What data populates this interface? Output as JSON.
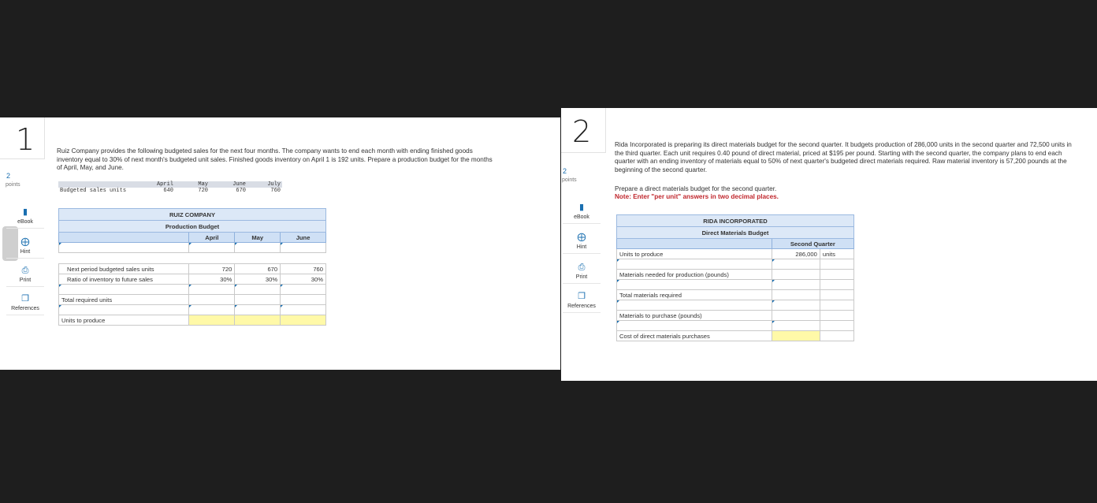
{
  "q1": {
    "number": "1",
    "points": "2",
    "points_label": "points",
    "tools": [
      "eBook",
      "Hint",
      "Print",
      "References"
    ],
    "problem": "Ruiz Company provides the following budgeted sales for the next four months. The company wants to end each month with ending finished goods inventory equal to 30% of next month's budgeted unit sales. Finished goods inventory on April 1 is 192 units. Prepare a production budget for the months of April, May, and June.",
    "given": {
      "row_label": "Budgeted sales units",
      "months": [
        "April",
        "May",
        "June",
        "July"
      ],
      "values": [
        "640",
        "720",
        "670",
        "760"
      ]
    },
    "table": {
      "company": "RUIZ COMPANY",
      "title": "Production Budget",
      "columns": [
        "April",
        "May",
        "June"
      ],
      "row_next_label": "Next period budgeted sales units",
      "row_next_values": [
        "720",
        "670",
        "760"
      ],
      "row_ratio_label": "Ratio of inventory to future sales",
      "row_ratio_values": [
        "30%",
        "30%",
        "30%"
      ],
      "total_required": "Total required units",
      "units_to_produce": "Units to produce"
    }
  },
  "q2": {
    "number": "2",
    "points": "2",
    "points_label": "points",
    "tools": [
      "eBook",
      "Hint",
      "Print",
      "References"
    ],
    "problem": "Rida Incorporated is preparing its direct materials budget for the second quarter. It budgets production of 286,000 units in the second quarter and 72,500 units in the third quarter. Each unit requires 0.40 pound of direct material, priced at $195 per pound. Starting with the second quarter, the company plans to end each quarter with an ending inventory of materials equal to 50% of next quarter's budgeted direct materials required. Raw material inventory is 57,200 pounds at the beginning of the second quarter.",
    "instruction": "Prepare a direct materials budget for the second quarter.",
    "note": "Note: Enter \"per unit\" answers in two decimal places.",
    "table": {
      "company": "RIDA INCORPORATED",
      "title": "Direct Materials Budget",
      "column": "Second Quarter",
      "units_to_produce": "Units to produce",
      "units_value": "286,000",
      "units_unit": "units",
      "materials_needed": "Materials needed for production (pounds)",
      "total_materials": "Total materials required",
      "materials_purchase": "Materials to purchase (pounds)",
      "cost_purchases": "Cost of direct materials purchases"
    }
  }
}
